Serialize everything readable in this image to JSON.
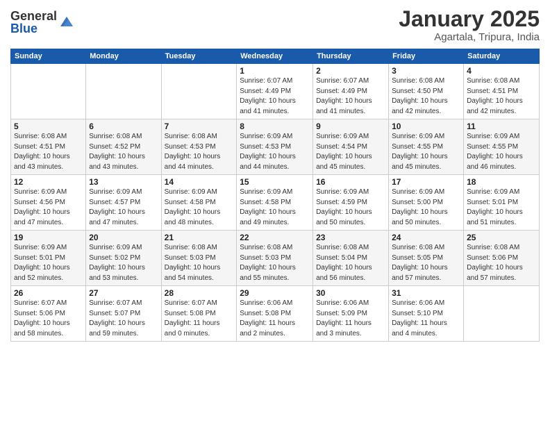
{
  "header": {
    "logo_general": "General",
    "logo_blue": "Blue",
    "month_title": "January 2025",
    "subtitle": "Agartala, Tripura, India"
  },
  "weekdays": [
    "Sunday",
    "Monday",
    "Tuesday",
    "Wednesday",
    "Thursday",
    "Friday",
    "Saturday"
  ],
  "weeks": [
    [
      {
        "day": "",
        "info": ""
      },
      {
        "day": "",
        "info": ""
      },
      {
        "day": "",
        "info": ""
      },
      {
        "day": "1",
        "info": "Sunrise: 6:07 AM\nSunset: 4:49 PM\nDaylight: 10 hours\nand 41 minutes."
      },
      {
        "day": "2",
        "info": "Sunrise: 6:07 AM\nSunset: 4:49 PM\nDaylight: 10 hours\nand 41 minutes."
      },
      {
        "day": "3",
        "info": "Sunrise: 6:08 AM\nSunset: 4:50 PM\nDaylight: 10 hours\nand 42 minutes."
      },
      {
        "day": "4",
        "info": "Sunrise: 6:08 AM\nSunset: 4:51 PM\nDaylight: 10 hours\nand 42 minutes."
      }
    ],
    [
      {
        "day": "5",
        "info": "Sunrise: 6:08 AM\nSunset: 4:51 PM\nDaylight: 10 hours\nand 43 minutes."
      },
      {
        "day": "6",
        "info": "Sunrise: 6:08 AM\nSunset: 4:52 PM\nDaylight: 10 hours\nand 43 minutes."
      },
      {
        "day": "7",
        "info": "Sunrise: 6:08 AM\nSunset: 4:53 PM\nDaylight: 10 hours\nand 44 minutes."
      },
      {
        "day": "8",
        "info": "Sunrise: 6:09 AM\nSunset: 4:53 PM\nDaylight: 10 hours\nand 44 minutes."
      },
      {
        "day": "9",
        "info": "Sunrise: 6:09 AM\nSunset: 4:54 PM\nDaylight: 10 hours\nand 45 minutes."
      },
      {
        "day": "10",
        "info": "Sunrise: 6:09 AM\nSunset: 4:55 PM\nDaylight: 10 hours\nand 45 minutes."
      },
      {
        "day": "11",
        "info": "Sunrise: 6:09 AM\nSunset: 4:55 PM\nDaylight: 10 hours\nand 46 minutes."
      }
    ],
    [
      {
        "day": "12",
        "info": "Sunrise: 6:09 AM\nSunset: 4:56 PM\nDaylight: 10 hours\nand 47 minutes."
      },
      {
        "day": "13",
        "info": "Sunrise: 6:09 AM\nSunset: 4:57 PM\nDaylight: 10 hours\nand 47 minutes."
      },
      {
        "day": "14",
        "info": "Sunrise: 6:09 AM\nSunset: 4:58 PM\nDaylight: 10 hours\nand 48 minutes."
      },
      {
        "day": "15",
        "info": "Sunrise: 6:09 AM\nSunset: 4:58 PM\nDaylight: 10 hours\nand 49 minutes."
      },
      {
        "day": "16",
        "info": "Sunrise: 6:09 AM\nSunset: 4:59 PM\nDaylight: 10 hours\nand 50 minutes."
      },
      {
        "day": "17",
        "info": "Sunrise: 6:09 AM\nSunset: 5:00 PM\nDaylight: 10 hours\nand 50 minutes."
      },
      {
        "day": "18",
        "info": "Sunrise: 6:09 AM\nSunset: 5:01 PM\nDaylight: 10 hours\nand 51 minutes."
      }
    ],
    [
      {
        "day": "19",
        "info": "Sunrise: 6:09 AM\nSunset: 5:01 PM\nDaylight: 10 hours\nand 52 minutes."
      },
      {
        "day": "20",
        "info": "Sunrise: 6:09 AM\nSunset: 5:02 PM\nDaylight: 10 hours\nand 53 minutes."
      },
      {
        "day": "21",
        "info": "Sunrise: 6:08 AM\nSunset: 5:03 PM\nDaylight: 10 hours\nand 54 minutes."
      },
      {
        "day": "22",
        "info": "Sunrise: 6:08 AM\nSunset: 5:03 PM\nDaylight: 10 hours\nand 55 minutes."
      },
      {
        "day": "23",
        "info": "Sunrise: 6:08 AM\nSunset: 5:04 PM\nDaylight: 10 hours\nand 56 minutes."
      },
      {
        "day": "24",
        "info": "Sunrise: 6:08 AM\nSunset: 5:05 PM\nDaylight: 10 hours\nand 57 minutes."
      },
      {
        "day": "25",
        "info": "Sunrise: 6:08 AM\nSunset: 5:06 PM\nDaylight: 10 hours\nand 57 minutes."
      }
    ],
    [
      {
        "day": "26",
        "info": "Sunrise: 6:07 AM\nSunset: 5:06 PM\nDaylight: 10 hours\nand 58 minutes."
      },
      {
        "day": "27",
        "info": "Sunrise: 6:07 AM\nSunset: 5:07 PM\nDaylight: 10 hours\nand 59 minutes."
      },
      {
        "day": "28",
        "info": "Sunrise: 6:07 AM\nSunset: 5:08 PM\nDaylight: 11 hours\nand 0 minutes."
      },
      {
        "day": "29",
        "info": "Sunrise: 6:06 AM\nSunset: 5:08 PM\nDaylight: 11 hours\nand 2 minutes."
      },
      {
        "day": "30",
        "info": "Sunrise: 6:06 AM\nSunset: 5:09 PM\nDaylight: 11 hours\nand 3 minutes."
      },
      {
        "day": "31",
        "info": "Sunrise: 6:06 AM\nSunset: 5:10 PM\nDaylight: 11 hours\nand 4 minutes."
      },
      {
        "day": "",
        "info": ""
      }
    ]
  ]
}
